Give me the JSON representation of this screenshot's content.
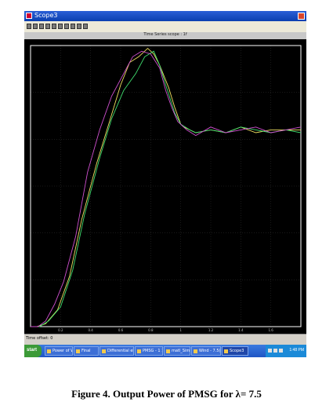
{
  "window": {
    "title": "Scope3"
  },
  "scope": {
    "title": "Time Series scope : 1f",
    "x_ticks": [
      "0.2",
      "0.4",
      "0.6",
      "0.8",
      "1",
      "1.2",
      "1.4",
      "1.6"
    ],
    "colors": {
      "background": "#000000",
      "frame": "#ffffff",
      "series_yellow": "#f0e060",
      "series_green": "#40e070",
      "series_magenta": "#d050d0"
    }
  },
  "status": {
    "text": "Time offset: 0"
  },
  "taskbar": {
    "start_label": "start",
    "items": [
      "Power of Wind Turb...",
      "Final",
      "Differential element...",
      "PMSG - 1 1 2010...",
      "matl_Simul",
      "Wind - 7.5(Model 1)",
      "Scope3"
    ],
    "clock": "1:48 PM"
  },
  "caption": "Figure 4. Output Power of PMSG for λ= 7.5",
  "chart_data": {
    "type": "line",
    "title": "",
    "xlabel": "",
    "ylabel": "",
    "xlim": [
      0,
      1.8
    ],
    "ylim": [
      0,
      1
    ],
    "grid": true,
    "series": [
      {
        "color": "#f0e060",
        "x": [
          0,
          0.04,
          0.1,
          0.18,
          0.26,
          0.34,
          0.44,
          0.52,
          0.6,
          0.66,
          0.72,
          0.78,
          0.82,
          0.86,
          0.92,
          0.96,
          1.0,
          1.02,
          1.1,
          1.2,
          1.3,
          1.4,
          1.5,
          1.6,
          1.7,
          1.8
        ],
        "y": [
          0,
          0,
          0.01,
          0.06,
          0.18,
          0.38,
          0.58,
          0.72,
          0.86,
          0.94,
          0.96,
          0.99,
          0.97,
          0.93,
          0.85,
          0.78,
          0.72,
          0.71,
          0.69,
          0.7,
          0.69,
          0.71,
          0.69,
          0.7,
          0.7,
          0.7
        ]
      },
      {
        "color": "#40e070",
        "x": [
          0,
          0.06,
          0.12,
          0.2,
          0.28,
          0.36,
          0.46,
          0.54,
          0.62,
          0.7,
          0.76,
          0.82,
          0.86,
          0.9,
          0.96,
          1.0,
          1.06,
          1.1,
          1.2,
          1.3,
          1.4,
          1.5,
          1.6,
          1.7,
          1.8
        ],
        "y": [
          0,
          0,
          0.02,
          0.07,
          0.2,
          0.4,
          0.6,
          0.74,
          0.84,
          0.9,
          0.96,
          0.98,
          0.93,
          0.86,
          0.76,
          0.72,
          0.7,
          0.69,
          0.7,
          0.69,
          0.71,
          0.7,
          0.69,
          0.7,
          0.69
        ]
      },
      {
        "color": "#d050d0",
        "x": [
          0,
          0.05,
          0.1,
          0.16,
          0.22,
          0.3,
          0.38,
          0.46,
          0.54,
          0.62,
          0.68,
          0.74,
          0.8,
          0.86,
          0.9,
          0.94,
          0.98,
          1.04,
          1.1,
          1.2,
          1.3,
          1.4,
          1.5,
          1.6,
          1.7,
          1.8
        ],
        "y": [
          0,
          0,
          0.02,
          0.08,
          0.16,
          0.32,
          0.55,
          0.7,
          0.82,
          0.9,
          0.96,
          0.98,
          0.97,
          0.92,
          0.84,
          0.78,
          0.73,
          0.7,
          0.68,
          0.71,
          0.69,
          0.7,
          0.71,
          0.69,
          0.7,
          0.71
        ]
      }
    ]
  }
}
